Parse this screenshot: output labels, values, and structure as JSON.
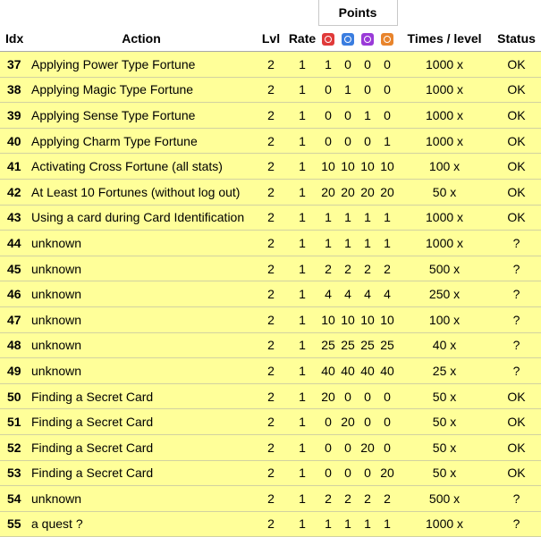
{
  "header": {
    "points": "Points",
    "idx": "Idx",
    "action": "Action",
    "lvl": "Lvl",
    "rate": "Rate",
    "times": "Times / level",
    "status": "Status"
  },
  "stat_icons": [
    {
      "name": "power-icon",
      "color": "#e03a3a"
    },
    {
      "name": "magic-icon",
      "color": "#3a7de0"
    },
    {
      "name": "sense-icon",
      "color": "#9a3ad8"
    },
    {
      "name": "charm-icon",
      "color": "#e8842c"
    }
  ],
  "rows": [
    {
      "idx": "37",
      "action": "Applying Power Type Fortune",
      "lvl": "2",
      "rate": "1",
      "p": [
        "1",
        "0",
        "0",
        "0"
      ],
      "times": "1000 x",
      "status": "OK"
    },
    {
      "idx": "38",
      "action": "Applying Magic Type Fortune",
      "lvl": "2",
      "rate": "1",
      "p": [
        "0",
        "1",
        "0",
        "0"
      ],
      "times": "1000 x",
      "status": "OK"
    },
    {
      "idx": "39",
      "action": "Applying Sense Type Fortune",
      "lvl": "2",
      "rate": "1",
      "p": [
        "0",
        "0",
        "1",
        "0"
      ],
      "times": "1000 x",
      "status": "OK"
    },
    {
      "idx": "40",
      "action": "Applying Charm Type Fortune",
      "lvl": "2",
      "rate": "1",
      "p": [
        "0",
        "0",
        "0",
        "1"
      ],
      "times": "1000 x",
      "status": "OK"
    },
    {
      "idx": "41",
      "action": "Activating Cross Fortune (all stats)",
      "lvl": "2",
      "rate": "1",
      "p": [
        "10",
        "10",
        "10",
        "10"
      ],
      "times": "100 x",
      "status": "OK"
    },
    {
      "idx": "42",
      "action": "At Least 10 Fortunes (without log out)",
      "lvl": "2",
      "rate": "1",
      "p": [
        "20",
        "20",
        "20",
        "20"
      ],
      "times": "50 x",
      "status": "OK"
    },
    {
      "idx": "43",
      "action": "Using a card during Card Identification",
      "lvl": "2",
      "rate": "1",
      "p": [
        "1",
        "1",
        "1",
        "1"
      ],
      "times": "1000 x",
      "status": "OK"
    },
    {
      "idx": "44",
      "action": "unknown",
      "lvl": "2",
      "rate": "1",
      "p": [
        "1",
        "1",
        "1",
        "1"
      ],
      "times": "1000 x",
      "status": "?"
    },
    {
      "idx": "45",
      "action": "unknown",
      "lvl": "2",
      "rate": "1",
      "p": [
        "2",
        "2",
        "2",
        "2"
      ],
      "times": "500 x",
      "status": "?"
    },
    {
      "idx": "46",
      "action": "unknown",
      "lvl": "2",
      "rate": "1",
      "p": [
        "4",
        "4",
        "4",
        "4"
      ],
      "times": "250 x",
      "status": "?"
    },
    {
      "idx": "47",
      "action": "unknown",
      "lvl": "2",
      "rate": "1",
      "p": [
        "10",
        "10",
        "10",
        "10"
      ],
      "times": "100 x",
      "status": "?"
    },
    {
      "idx": "48",
      "action": "unknown",
      "lvl": "2",
      "rate": "1",
      "p": [
        "25",
        "25",
        "25",
        "25"
      ],
      "times": "40 x",
      "status": "?"
    },
    {
      "idx": "49",
      "action": "unknown",
      "lvl": "2",
      "rate": "1",
      "p": [
        "40",
        "40",
        "40",
        "40"
      ],
      "times": "25 x",
      "status": "?"
    },
    {
      "idx": "50",
      "action": "Finding a Secret Card",
      "lvl": "2",
      "rate": "1",
      "p": [
        "20",
        "0",
        "0",
        "0"
      ],
      "times": "50 x",
      "status": "OK"
    },
    {
      "idx": "51",
      "action": "Finding a Secret Card",
      "lvl": "2",
      "rate": "1",
      "p": [
        "0",
        "20",
        "0",
        "0"
      ],
      "times": "50 x",
      "status": "OK"
    },
    {
      "idx": "52",
      "action": "Finding a Secret Card",
      "lvl": "2",
      "rate": "1",
      "p": [
        "0",
        "0",
        "20",
        "0"
      ],
      "times": "50 x",
      "status": "OK"
    },
    {
      "idx": "53",
      "action": "Finding a Secret Card",
      "lvl": "2",
      "rate": "1",
      "p": [
        "0",
        "0",
        "0",
        "20"
      ],
      "times": "50 x",
      "status": "OK"
    },
    {
      "idx": "54",
      "action": "unknown",
      "lvl": "2",
      "rate": "1",
      "p": [
        "2",
        "2",
        "2",
        "2"
      ],
      "times": "500 x",
      "status": "?"
    },
    {
      "idx": "55",
      "action": "a quest ?",
      "lvl": "2",
      "rate": "1",
      "p": [
        "1",
        "1",
        "1",
        "1"
      ],
      "times": "1000 x",
      "status": "?"
    }
  ]
}
